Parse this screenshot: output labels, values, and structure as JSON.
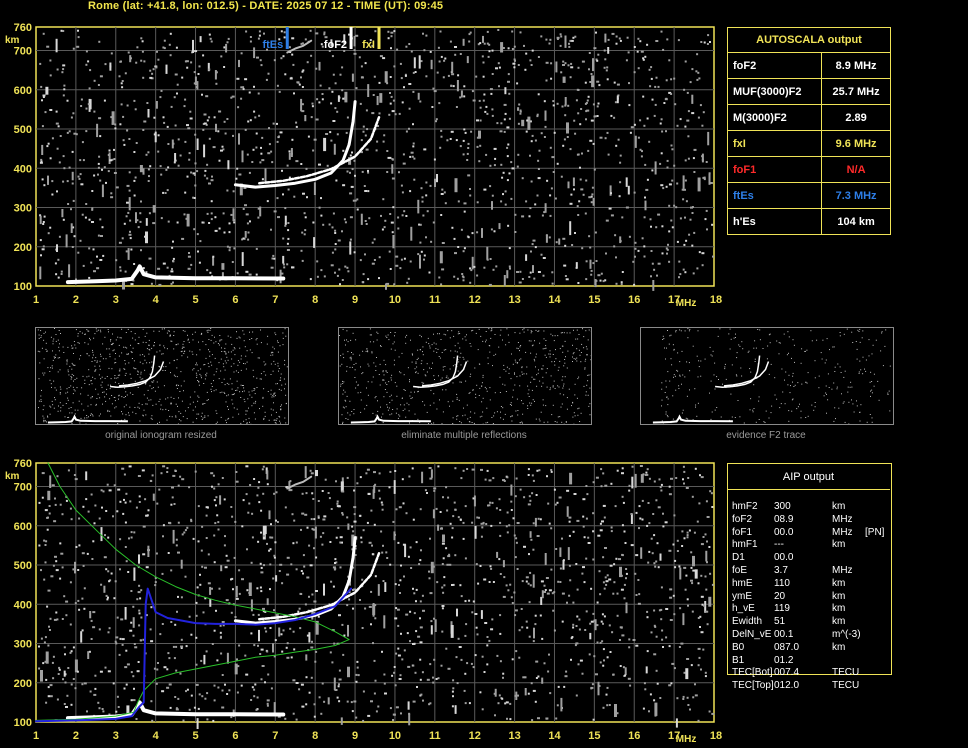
{
  "header": {
    "title": "Rome (lat: +41.8, lon: 012.5) - DATE: 2025 07 12 - TIME (UT): 09:45"
  },
  "colors": {
    "frame": "#f0e357",
    "trace": "#ffffff",
    "noise": "#a0a0a0",
    "fte_marker": "#2e7fe8",
    "fof2_marker": "#ffffff",
    "fxi_marker": "#f0e357",
    "model_profile": "#2ac02a",
    "true_height": "#2222dd",
    "na_red": "#ff2a2a"
  },
  "chart_data": [
    {
      "type": "scatter",
      "panel": "autoscala-ionogram",
      "x_unit": "MHz",
      "y_unit": "km",
      "xlim": [
        1,
        18
      ],
      "ylim": [
        100,
        760
      ],
      "x_ticks": [
        "1",
        "2",
        "3",
        "4",
        "5",
        "6",
        "7",
        "8",
        "9",
        "10",
        "11",
        "12",
        "13",
        "14",
        "15",
        "16",
        "17",
        "18"
      ],
      "y_ticks": [
        "100",
        "200",
        "300",
        "400",
        "500",
        "600",
        "700",
        "760"
      ],
      "grid": true,
      "markers": [
        {
          "label": "ftEs",
          "x": 7.3,
          "color": "#2e7fe8"
        },
        {
          "label": "foF2",
          "x": 8.9,
          "color": "#ffffff"
        },
        {
          "label": "fxI",
          "x": 9.6,
          "color": "#f0e357"
        }
      ],
      "series": [
        {
          "points": [
            [
              1.8,
              110
            ],
            [
              2.5,
              112
            ],
            [
              3.0,
              114
            ],
            [
              3.4,
              118
            ],
            [
              3.55,
              140
            ],
            [
              3.6,
              150
            ],
            [
              3.7,
              130
            ],
            [
              4.0,
              122
            ],
            [
              5.0,
              120
            ],
            [
              6.0,
              120
            ],
            [
              7.2,
              119
            ]
          ]
        },
        {
          "points": [
            [
              6.0,
              358
            ],
            [
              6.5,
              352
            ],
            [
              7.0,
              356
            ],
            [
              7.5,
              362
            ],
            [
              8.0,
              372
            ],
            [
              8.4,
              388
            ],
            [
              8.7,
              420
            ],
            [
              8.85,
              460
            ],
            [
              8.95,
              520
            ],
            [
              9.0,
              570
            ]
          ]
        },
        {
          "points": [
            [
              6.6,
              362
            ],
            [
              7.2,
              368
            ],
            [
              7.8,
              380
            ],
            [
              8.4,
              398
            ],
            [
              9.0,
              430
            ],
            [
              9.4,
              475
            ],
            [
              9.6,
              530
            ]
          ]
        },
        {
          "points": [
            [
              7.3,
              695
            ],
            [
              7.5,
              705
            ],
            [
              7.7,
              712
            ],
            [
              7.9,
              725
            ]
          ]
        }
      ]
    },
    {
      "type": "line",
      "panel": "aip-ionogram",
      "x_unit": "MHz",
      "y_unit": "km",
      "xlim": [
        1,
        18
      ],
      "ylim": [
        100,
        760
      ],
      "x_ticks": [
        "1",
        "2",
        "3",
        "4",
        "5",
        "6",
        "7",
        "8",
        "9",
        "10",
        "11",
        "12",
        "13",
        "14",
        "15",
        "16",
        "17",
        "18"
      ],
      "y_ticks": [
        "100",
        "200",
        "300",
        "400",
        "500",
        "600",
        "700",
        "760"
      ],
      "grid": true,
      "series": [
        {
          "points": [
            [
              1.8,
              110
            ],
            [
              2.5,
              112
            ],
            [
              3.0,
              114
            ],
            [
              3.4,
              118
            ],
            [
              3.55,
              140
            ],
            [
              3.6,
              150
            ],
            [
              3.7,
              130
            ],
            [
              4.0,
              122
            ],
            [
              5.0,
              120
            ],
            [
              6.0,
              120
            ],
            [
              7.2,
              119
            ]
          ]
        },
        {
          "points": [
            [
              6.0,
              358
            ],
            [
              6.5,
              352
            ],
            [
              7.0,
              356
            ],
            [
              7.5,
              362
            ],
            [
              8.0,
              372
            ],
            [
              8.4,
              388
            ],
            [
              8.7,
              420
            ],
            [
              8.85,
              460
            ],
            [
              8.95,
              520
            ],
            [
              9.0,
              570
            ]
          ]
        },
        {
          "points": [
            [
              6.6,
              362
            ],
            [
              7.2,
              368
            ],
            [
              7.8,
              380
            ],
            [
              8.4,
              398
            ],
            [
              9.0,
              430
            ],
            [
              9.4,
              475
            ],
            [
              9.6,
              530
            ]
          ]
        },
        {
          "points": [
            [
              7.3,
              695
            ],
            [
              7.5,
              705
            ],
            [
              7.7,
              712
            ],
            [
              7.9,
              725
            ]
          ]
        },
        {
          "points": [
            [
              1.3,
              760
            ],
            [
              1.6,
              700
            ],
            [
              2.0,
              640
            ],
            [
              2.5,
              590
            ],
            [
              3.0,
              540
            ],
            [
              3.5,
              500
            ],
            [
              4.0,
              470
            ],
            [
              4.5,
              445
            ],
            [
              5.0,
              425
            ],
            [
              5.5,
              410
            ],
            [
              6.0,
              398
            ],
            [
              6.5,
              388
            ],
            [
              7.0,
              378
            ],
            [
              7.5,
              368
            ],
            [
              8.0,
              355
            ],
            [
              8.5,
              330
            ],
            [
              8.85,
              310
            ],
            [
              8.5,
              295
            ],
            [
              8.0,
              285
            ],
            [
              7.5,
              278
            ],
            [
              7.0,
              270
            ],
            [
              6.5,
              265
            ],
            [
              6.0,
              255
            ],
            [
              5.5,
              245
            ],
            [
              5.0,
              235
            ],
            [
              4.5,
              225
            ],
            [
              4.0,
              210
            ],
            [
              3.7,
              180
            ],
            [
              3.55,
              150
            ],
            [
              3.45,
              125
            ],
            [
              3.0,
              115
            ],
            [
              2.0,
              107
            ],
            [
              1.0,
              104
            ]
          ]
        },
        {
          "points": [
            [
              1.0,
              102
            ],
            [
              2.0,
              104
            ],
            [
              3.0,
              108
            ],
            [
              3.4,
              115
            ],
            [
              3.6,
              140
            ],
            [
              3.7,
              150
            ],
            [
              3.75,
              400
            ],
            [
              3.8,
              440
            ],
            [
              4.0,
              380
            ],
            [
              4.3,
              365
            ],
            [
              5.0,
              352
            ],
            [
              5.5,
              350
            ],
            [
              6.0,
              350
            ],
            [
              6.5,
              348
            ],
            [
              7.0,
              352
            ],
            [
              7.5,
              360
            ],
            [
              8.0,
              375
            ],
            [
              8.5,
              395
            ],
            [
              8.9,
              440
            ]
          ]
        }
      ]
    }
  ],
  "thumbnails": [
    {
      "caption": "original ionogram resized"
    },
    {
      "caption": "eliminate multiple reflections"
    },
    {
      "caption": "evidence F2 trace"
    }
  ],
  "autoscala": {
    "title": "AUTOSCALA output",
    "rows": [
      {
        "label": "foF2",
        "value": "8.9 MHz",
        "color": "#ffffff"
      },
      {
        "label": "MUF(3000)F2",
        "value": "25.7 MHz",
        "color": "#ffffff"
      },
      {
        "label": "M(3000)F2",
        "value": "2.89",
        "color": "#ffffff"
      },
      {
        "label": "fxI",
        "value": "9.6 MHz",
        "color": "#f0e357"
      },
      {
        "label": "foF1",
        "value": "N/A",
        "color": "#ff2a2a"
      },
      {
        "label": "ftEs",
        "value": "7.3 MHz",
        "color": "#2e7fe8"
      },
      {
        "label": "h'Es",
        "value": "104    km",
        "color": "#ffffff"
      }
    ]
  },
  "aip": {
    "title": "AIP output",
    "rows": [
      {
        "name": "hmF2",
        "value": "300",
        "unit": "km",
        "extra": ""
      },
      {
        "name": "foF2",
        "value": "08.9",
        "unit": "MHz",
        "extra": ""
      },
      {
        "name": "foF1",
        "value": "00.0",
        "unit": "MHz",
        "extra": "[PN]"
      },
      {
        "name": "hmF1",
        "value": "---",
        "unit": "km",
        "extra": ""
      },
      {
        "name": "D1",
        "value": "00.0",
        "unit": "",
        "extra": ""
      },
      {
        "name": "foE",
        "value": "3.7",
        "unit": "MHz",
        "extra": ""
      },
      {
        "name": "hmE",
        "value": "110",
        "unit": "km",
        "extra": ""
      },
      {
        "name": "ymE",
        "value": "20",
        "unit": "km",
        "extra": ""
      },
      {
        "name": "h_vE",
        "value": "119",
        "unit": "km",
        "extra": ""
      },
      {
        "name": "Ewidth",
        "value": "51",
        "unit": "km",
        "extra": ""
      },
      {
        "name": "DelN_vE",
        "value": "00.1",
        "unit": "m^(-3)",
        "extra": ""
      },
      {
        "name": "B0",
        "value": "087.0",
        "unit": "km",
        "extra": ""
      },
      {
        "name": "B1",
        "value": "01.2",
        "unit": "",
        "extra": ""
      },
      {
        "name": "TEC[Bot]",
        "value": "007.4",
        "unit": "TECU",
        "extra": ""
      },
      {
        "name": "TEC[Top]",
        "value": "012.0",
        "unit": "TECU",
        "extra": ""
      }
    ]
  }
}
